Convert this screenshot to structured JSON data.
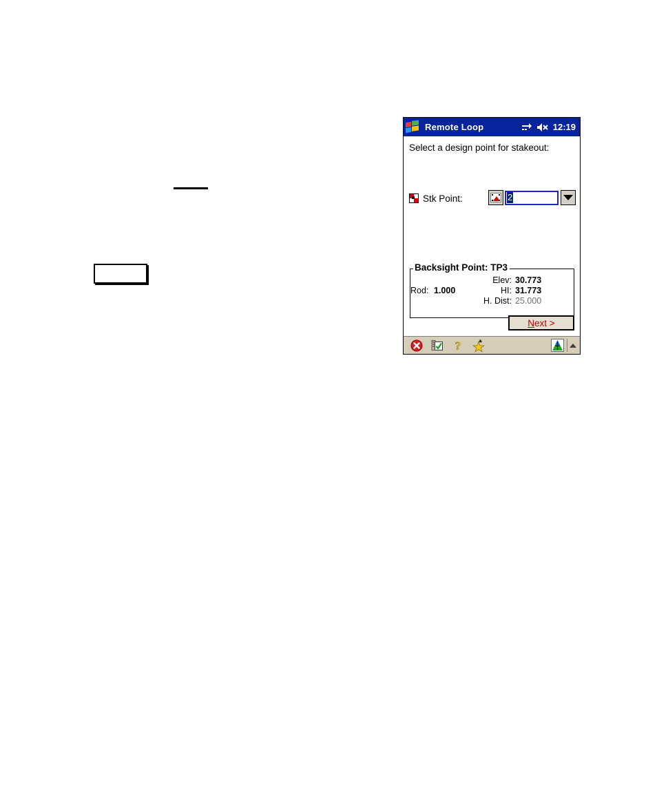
{
  "document": {
    "artifacts": {
      "rule_label": "",
      "box_label": ""
    }
  },
  "device": {
    "titlebar": {
      "logo_icon": "windows-flag-icon",
      "title": "Remote Loop",
      "connectivity_icon": "connectivity-arrows-icon",
      "volume_icon": "speaker-mute-icon",
      "clock": "12:19"
    },
    "client": {
      "prompt": "Select a design point for stakeout:",
      "stk_point": {
        "badge_icon": "point-marker-icon",
        "label": "Stk Point:",
        "picker_icon": "map-pick-point-icon",
        "value": "2",
        "dropdown_icon": "chevron-down-icon"
      },
      "backsight": {
        "legend": "Backsight Point: TP3",
        "rod_label": "Rod:",
        "rod_value": "1.000",
        "rows": [
          {
            "label": "Elev:",
            "value": "30.773",
            "dim": false
          },
          {
            "label": "HI:",
            "value": "31.773",
            "dim": false
          },
          {
            "label": "H. Dist:",
            "value": "25.000",
            "dim": true
          }
        ]
      },
      "next_button": {
        "accel": "N",
        "rest": "ext >",
        "color": "#c00000"
      }
    },
    "taskbar": {
      "icons": [
        {
          "name": "close-icon",
          "title": "Close"
        },
        {
          "name": "notes-checklist-icon",
          "title": "Notes"
        },
        {
          "name": "help-question-icon",
          "title": "Help"
        },
        {
          "name": "favorites-star-icon",
          "title": "Favorites"
        }
      ],
      "status_icon": "survey-app-icon",
      "expand_icon": "up-arrow-icon"
    }
  },
  "colors": {
    "titlebar_bg": "#08249c",
    "taskbar_bg": "#d6cdb8",
    "button_face": "#d4d0c8",
    "accent_red": "#c00000",
    "selection_blue": "#0a246a",
    "field_border": "#2222cc"
  }
}
